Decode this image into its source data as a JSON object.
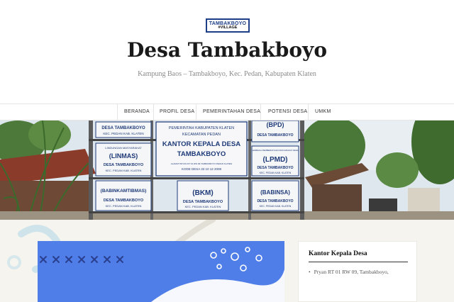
{
  "header": {
    "logo": {
      "line1": "TAMBAKBOYO",
      "line2": "#VILLAGE"
    },
    "site_title": "Desa Tambakboyo",
    "tagline": "Kampung Baos – Tambakboyo, Kec. Pedan, Kabupaten Klaten"
  },
  "nav": {
    "items": [
      {
        "label": "BERANDA"
      },
      {
        "label": "PROFIL DESA"
      },
      {
        "label": "PEMERINTAHAN DESA"
      },
      {
        "label": "POTENSI DESA"
      },
      {
        "label": "UMKM"
      }
    ]
  },
  "hero": {
    "signs": {
      "top_left": {
        "line1": "DESA TAMBAKBOYO",
        "line2": "KEC. PEDAN KAB. KLATEN"
      },
      "linmas": {
        "small": "LINDUNGAN MASYARAKAT",
        "title": "(LINMAS)",
        "line1": "DESA TAMBAKBOYO",
        "line2": "KEC. PEDAN KAB. KLATEN"
      },
      "babinkamtibmas": {
        "title": "(BABINKAMTIBMAS)",
        "line1": "DESA TAMBAKBOYO",
        "line2": "KEC. PEDAN KAB. KLATEN"
      },
      "kantor": {
        "line1": "PEMERINTAH KABUPATEN KLATEN",
        "line2": "KECAMATAN PEDAN",
        "title1": "KANTOR KEPALA DESA",
        "title2": "TAMBAKBOYO",
        "addr": "ALAMAT PRYAN RT 01 RW 09 TAMBAKBOYO PEDAN KLATEN",
        "code": "KODE DESA 33 10 12 2008"
      },
      "bkm": {
        "title": "(BKM)",
        "line1": "DESA TAMBAKBOYO",
        "line2": "KEC. PEDAN KAB. KLATEN"
      },
      "bpd": {
        "title": "(BPD)",
        "line1": "DESA TAMBAKBOYO"
      },
      "lpmd": {
        "small": "LEMBAGA PEMBERDAYAAN MASYARAKAT DESA",
        "title": "(LPMD)",
        "line1": "DESA TAMBAKBOYO",
        "line2": "KEC. PEDAN KAB. KLATEN"
      },
      "babinsa": {
        "title": "(BABINSA)",
        "line1": "DESA TAMBAKBOYO",
        "line2": "KEC. PEDAN KAB. KLATEN"
      }
    }
  },
  "sidebar": {
    "widget_title": "Kantor Kepala Desa",
    "items": [
      {
        "text": "Pryan RT 01 RW 09, Tambakboyo,"
      }
    ]
  },
  "colors": {
    "post_card": "#4f7ee8",
    "background": "#f6f4ef",
    "logo_border": "#1d3f8a"
  }
}
